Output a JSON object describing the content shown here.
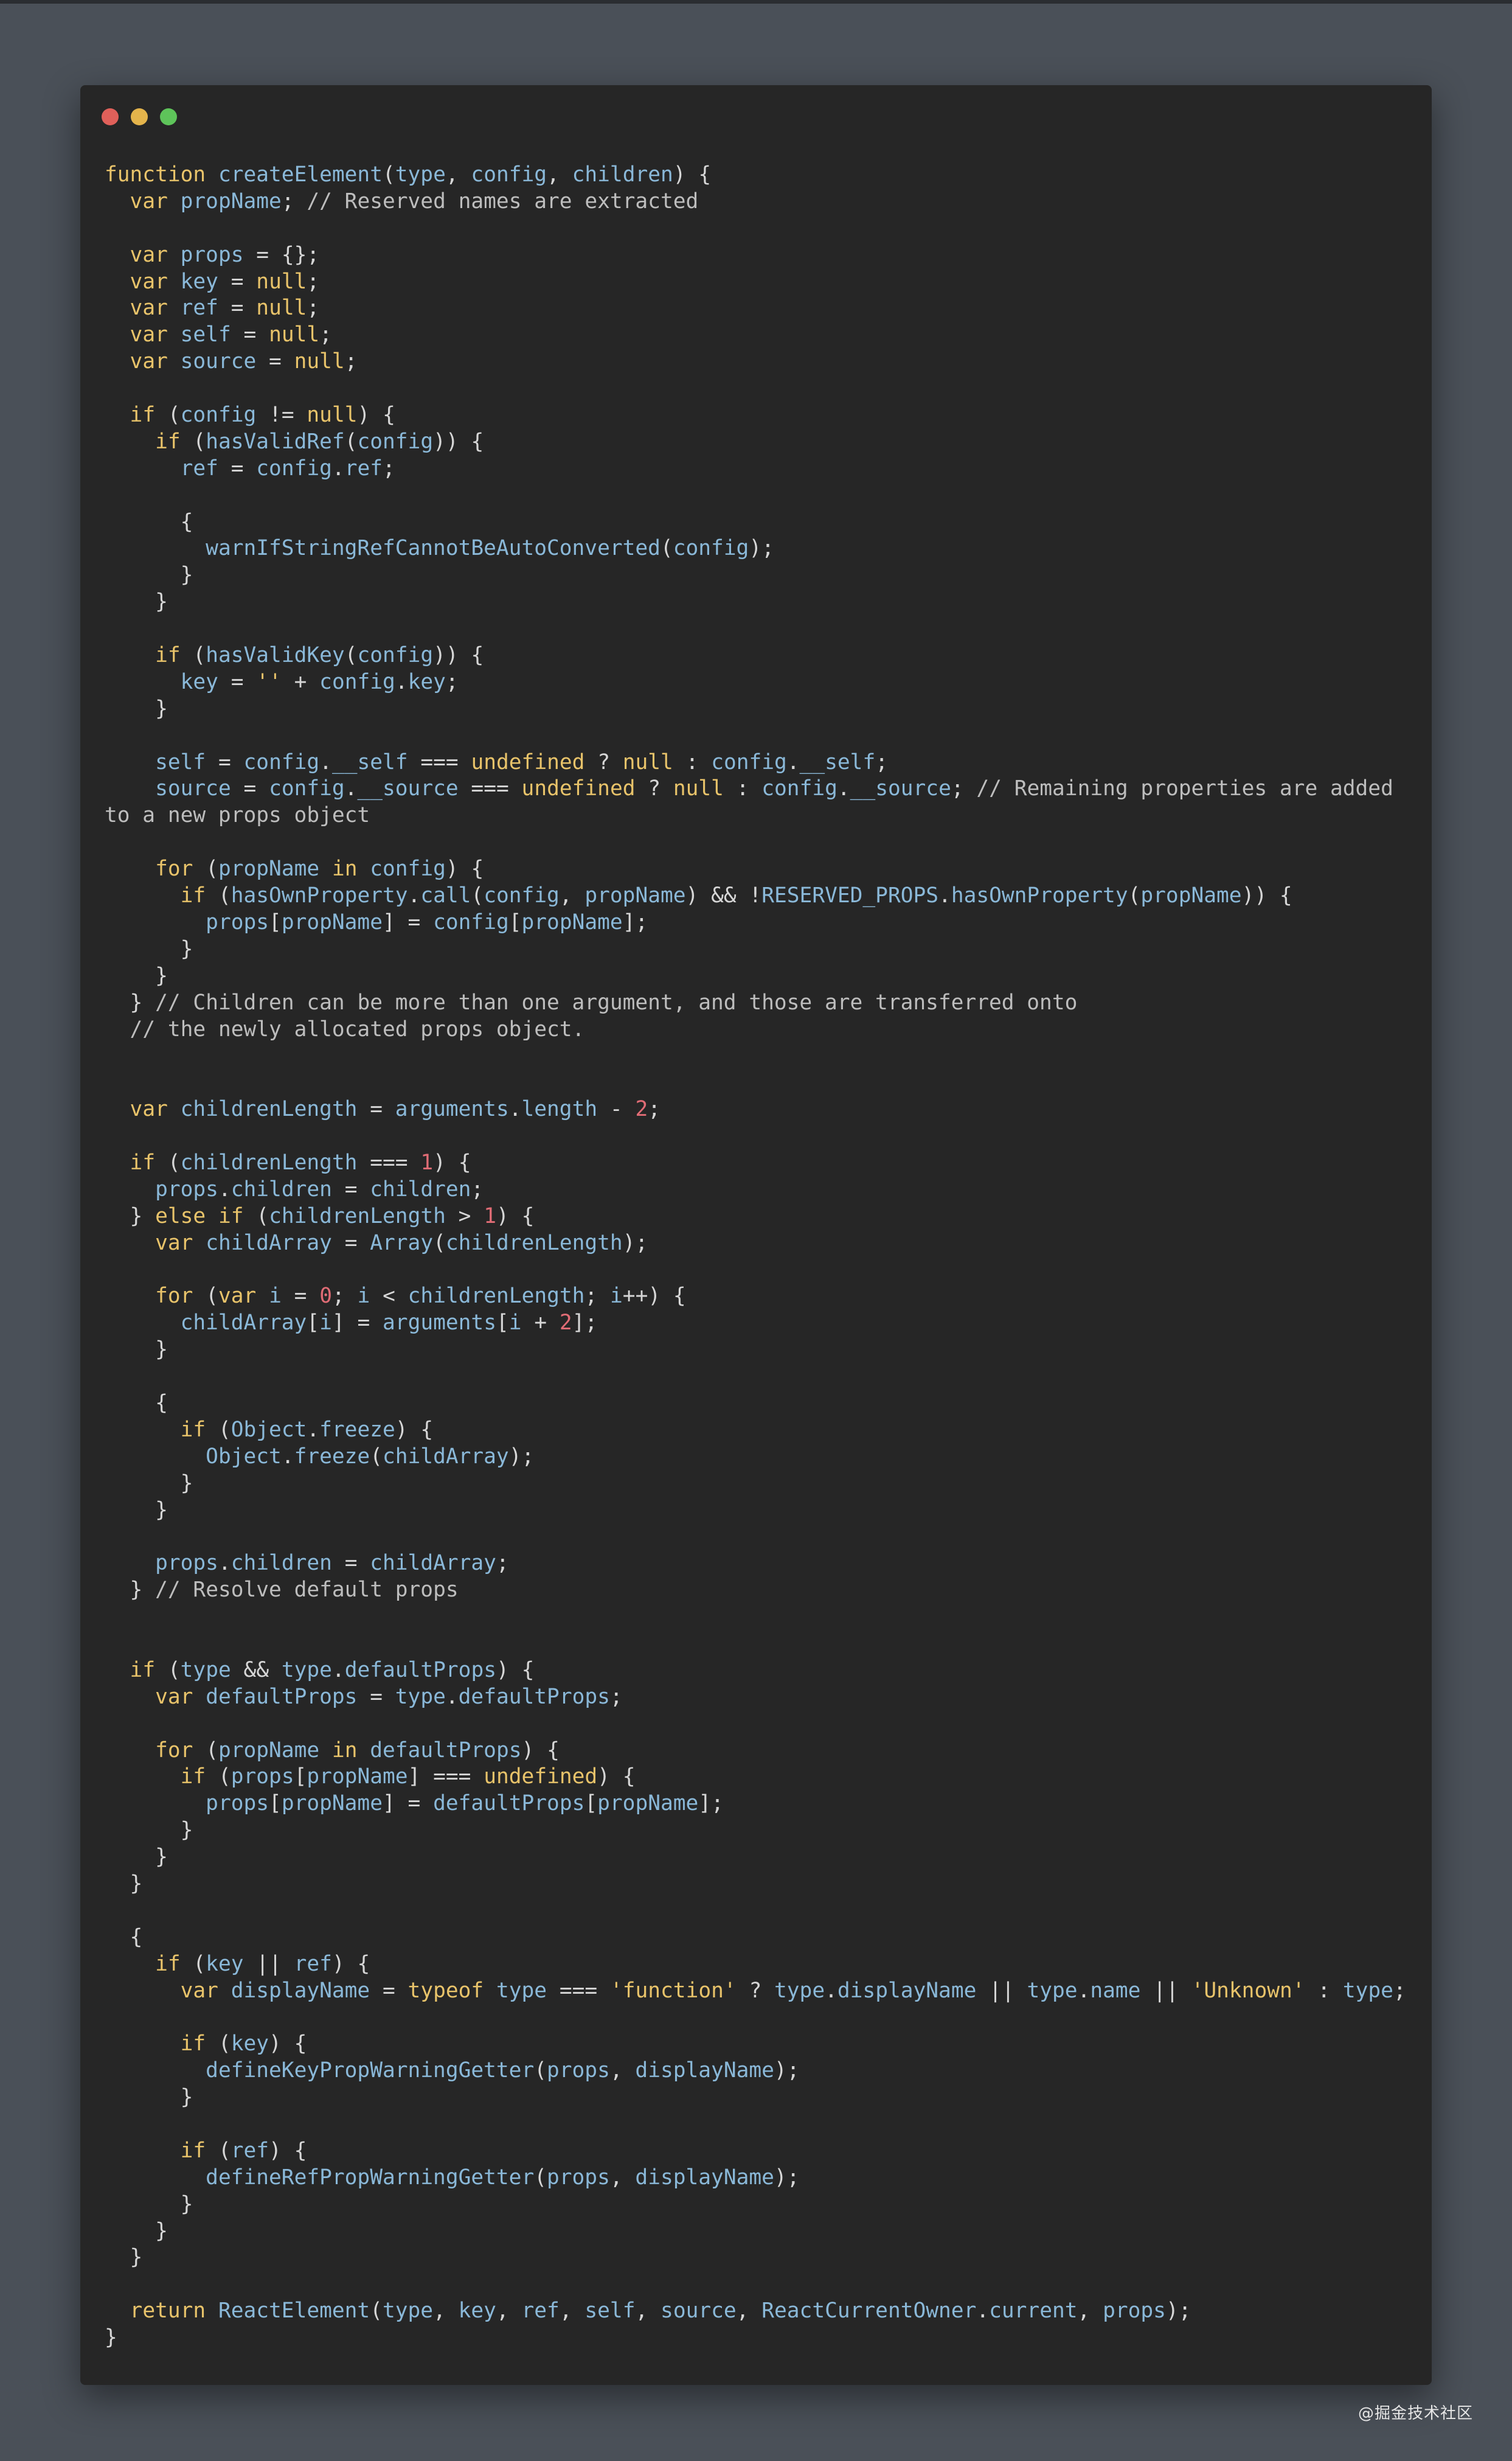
{
  "window": {
    "controls": [
      "close",
      "minimize",
      "maximize"
    ],
    "colors": {
      "close": "#e0605a",
      "minimize": "#e4b44b",
      "maximize": "#5ec45a"
    }
  },
  "code": {
    "language": "javascript",
    "lines": [
      "function createElement(type, config, children) {",
      "  var propName; // Reserved names are extracted",
      "",
      "  var props = {};",
      "  var key = null;",
      "  var ref = null;",
      "  var self = null;",
      "  var source = null;",
      "",
      "  if (config != null) {",
      "    if (hasValidRef(config)) {",
      "      ref = config.ref;",
      "",
      "      {",
      "        warnIfStringRefCannotBeAutoConverted(config);",
      "      }",
      "    }",
      "",
      "    if (hasValidKey(config)) {",
      "      key = '' + config.key;",
      "    }",
      "",
      "    self = config.__self === undefined ? null : config.__self;",
      "    source = config.__source === undefined ? null : config.__source; // Remaining properties are added",
      "to a new props object",
      "",
      "    for (propName in config) {",
      "      if (hasOwnProperty.call(config, propName) && !RESERVED_PROPS.hasOwnProperty(propName)) {",
      "        props[propName] = config[propName];",
      "      }",
      "    }",
      "  } // Children can be more than one argument, and those are transferred onto",
      "  // the newly allocated props object.",
      "",
      "",
      "  var childrenLength = arguments.length - 2;",
      "",
      "  if (childrenLength === 1) {",
      "    props.children = children;",
      "  } else if (childrenLength > 1) {",
      "    var childArray = Array(childrenLength);",
      "",
      "    for (var i = 0; i < childrenLength; i++) {",
      "      childArray[i] = arguments[i + 2];",
      "    }",
      "",
      "    {",
      "      if (Object.freeze) {",
      "        Object.freeze(childArray);",
      "      }",
      "    }",
      "",
      "    props.children = childArray;",
      "  } // Resolve default props",
      "",
      "",
      "  if (type && type.defaultProps) {",
      "    var defaultProps = type.defaultProps;",
      "",
      "    for (propName in defaultProps) {",
      "      if (props[propName] === undefined) {",
      "        props[propName] = defaultProps[propName];",
      "      }",
      "    }",
      "  }",
      "",
      "  {",
      "    if (key || ref) {",
      "      var displayName = typeof type === 'function' ? type.displayName || type.name || 'Unknown' : type;",
      "",
      "      if (key) {",
      "        defineKeyPropWarningGetter(props, displayName);",
      "      }",
      "",
      "      if (ref) {",
      "        defineRefPropWarningGetter(props, displayName);",
      "      }",
      "    }",
      "  }",
      "",
      "  return ReactElement(type, key, ref, self, source, ReactCurrentOwner.current, props);",
      "}"
    ]
  },
  "watermark": "@掘金技术社区"
}
